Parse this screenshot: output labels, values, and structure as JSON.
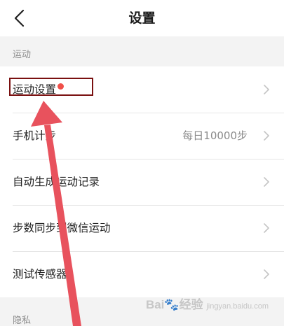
{
  "header": {
    "title": "设置",
    "back_icon": "chevron-left-icon"
  },
  "sections": [
    {
      "title": "运动",
      "rows": [
        {
          "label": "运动设置",
          "value": "",
          "has_dot": true
        },
        {
          "label": "手机计步",
          "value": "每日10000步"
        },
        {
          "label": "自动生成运动记录",
          "value": ""
        },
        {
          "label": "步数同步到微信运动",
          "value": ""
        },
        {
          "label": "测试传感器",
          "value": ""
        }
      ]
    },
    {
      "title": "隐私",
      "rows": []
    }
  ],
  "annotations": {
    "highlight_color": "#7a1010",
    "arrow_color": "#e8525d",
    "dot_color": "#f0504a"
  },
  "watermark": {
    "text": "Bai",
    "suffix": "经验",
    "sub": "jingyan.baidu.com"
  }
}
